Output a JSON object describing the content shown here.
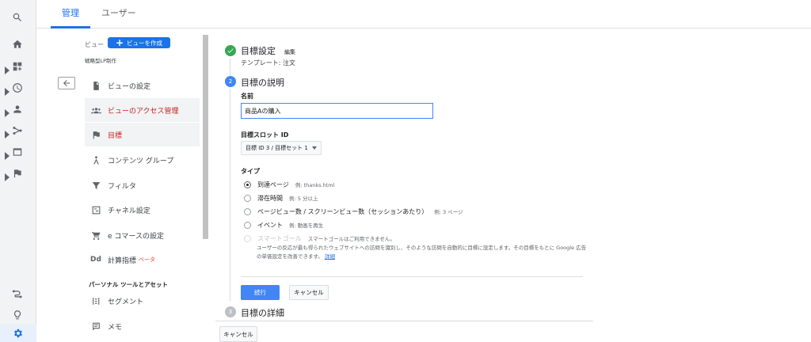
{
  "tabs": [
    {
      "label": "管理",
      "active": true
    },
    {
      "label": "ユーザー",
      "active": false
    }
  ],
  "rail": {
    "icons": [
      "search-icon",
      "home-icon",
      "customization-icon",
      "realtime-icon",
      "audience-icon",
      "acquisition-icon",
      "behavior-icon",
      "conversions-icon",
      "attribution-icon",
      "discover-icon",
      "settings-icon"
    ]
  },
  "nav": {
    "view_label": "ビュー",
    "create_view": "ビューを作成",
    "view_name": "戦略型LP制作",
    "items": [
      {
        "label": "ビューの設定",
        "icon": "document-icon"
      },
      {
        "label": "ビューのアクセス管理",
        "icon": "people-icon"
      },
      {
        "label": "目標",
        "icon": "flag-icon"
      },
      {
        "label": "コンテンツ グループ",
        "icon": "content-group-icon"
      },
      {
        "label": "フィルタ",
        "icon": "filter-icon"
      },
      {
        "label": "チャネル設定",
        "icon": "channel-icon"
      },
      {
        "label": "e コマースの設定",
        "icon": "cart-icon"
      },
      {
        "label": "計算指標",
        "icon": "dd-icon",
        "beta": "ベータ"
      }
    ],
    "section_title": "パーソナル ツールとアセット",
    "tools": [
      {
        "label": "セグメント",
        "icon": "segment-icon"
      },
      {
        "label": "メモ",
        "icon": "note-icon"
      }
    ]
  },
  "goal": {
    "step1": {
      "title": "目標設定",
      "edit": "編集",
      "template": "テンプレート: 注文"
    },
    "step2": {
      "number": "2",
      "title": "目標の説明"
    },
    "name_label": "名前",
    "name_value": "商品Aの購入",
    "slot_label": "目標スロット ID",
    "slot_value": "目標 ID 3 / 目標セット 1",
    "type_label": "タイプ",
    "types": [
      {
        "label": "到達ページ",
        "example": "例: thanks.html",
        "checked": true,
        "disabled": false
      },
      {
        "label": "滞在時間",
        "example": "例: 5 分以上",
        "checked": false,
        "disabled": false
      },
      {
        "label": "ページビュー数 / スクリーンビュー数（セッションあたり）",
        "example": "例: 3 ページ",
        "checked": false,
        "disabled": false
      },
      {
        "label": "イベント",
        "example": "例: 動画を再生",
        "checked": false,
        "disabled": false
      },
      {
        "label": "スマートゴール",
        "example": "スマートゴールはご利用できません。",
        "checked": false,
        "disabled": true
      }
    ],
    "smart_note": "ユーザーの反応が最も得られたウェブサイトへの訪問を識別し、そのような訪問を自動的に目標に設定します。その目標をもとに Google 広告の単価設定を改善できます。",
    "smart_note_link": "詳細",
    "continue": "続行",
    "cancel": "キャンセル",
    "step3": {
      "number": "3",
      "title": "目標の詳細"
    },
    "bottom_cancel": "キャンセル"
  },
  "colors": {
    "accent": "#1a73e8",
    "success": "#34a853",
    "highlight_text": "#c5221f"
  }
}
